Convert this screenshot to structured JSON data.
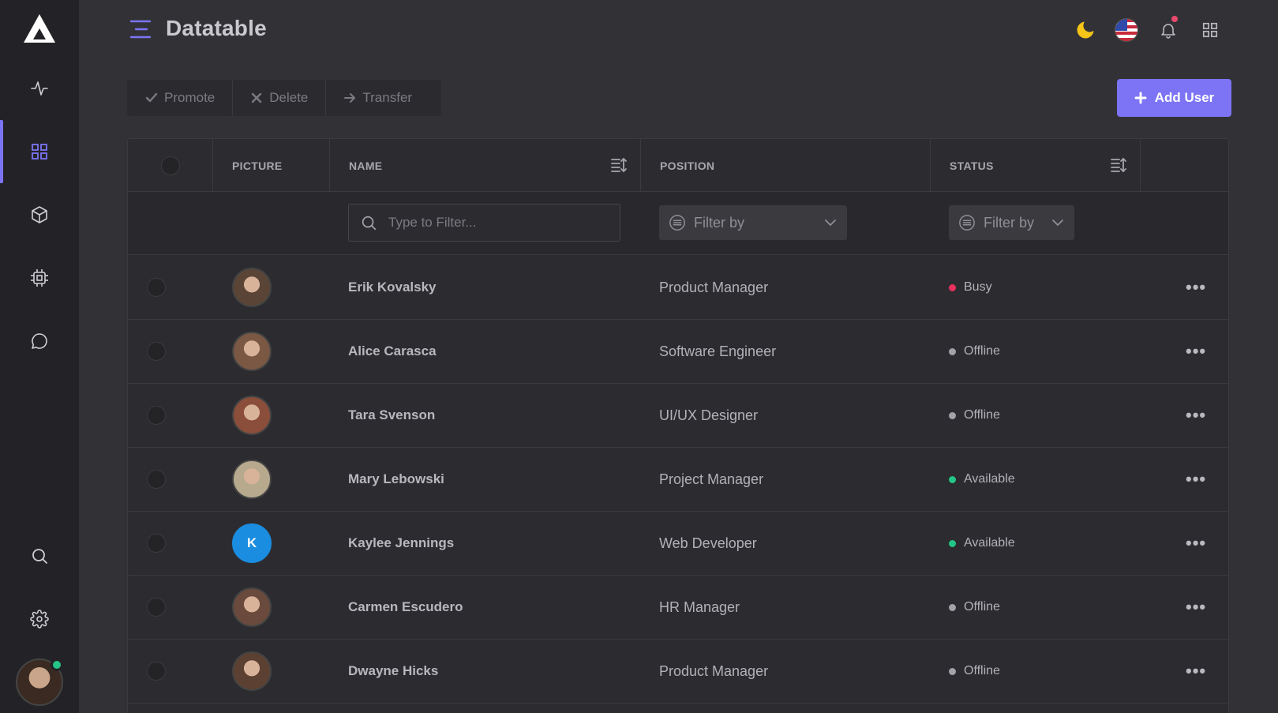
{
  "header": {
    "title": "Datatable",
    "icons": [
      "menu-icon",
      "moon-icon",
      "us-flag-icon",
      "bell-icon",
      "apps-grid-icon"
    ]
  },
  "sidebar": {
    "items": [
      {
        "icon": "activity-icon"
      },
      {
        "icon": "dashboard-grid-icon",
        "active": true
      },
      {
        "icon": "box-icon"
      },
      {
        "icon": "cpu-icon"
      },
      {
        "icon": "chat-icon"
      },
      {
        "icon": "search-icon"
      },
      {
        "icon": "gear-icon"
      }
    ],
    "user_status_color": "#25c487"
  },
  "toolbar": {
    "promote_label": "Promote",
    "delete_label": "Delete",
    "transfer_label": "Transfer",
    "add_user_label": "Add User"
  },
  "table": {
    "columns": {
      "picture": "PICTURE",
      "name": "NAME",
      "position": "POSITION",
      "status": "STATUS"
    },
    "filters": {
      "name_placeholder": "Type to Filter...",
      "position_select": "Filter by",
      "status_select": "Filter by"
    },
    "rows": [
      {
        "name": "Erik Kovalsky",
        "position": "Product Manager",
        "status": "Busy",
        "status_color": "#e8305f",
        "avatar_initial": "",
        "avatar_color": "#5a4436"
      },
      {
        "name": "Alice Carasca",
        "position": "Software Engineer",
        "status": "Offline",
        "status_color": "#a2a2aa",
        "avatar_initial": "",
        "avatar_color": "#7a5844"
      },
      {
        "name": "Tara Svenson",
        "position": "UI/UX Designer",
        "status": "Offline",
        "status_color": "#a2a2aa",
        "avatar_initial": "",
        "avatar_color": "#8a4e3a"
      },
      {
        "name": "Mary Lebowski",
        "position": "Project Manager",
        "status": "Available",
        "status_color": "#25c487",
        "avatar_initial": "",
        "avatar_color": "#b7a98e"
      },
      {
        "name": "Kaylee Jennings",
        "position": "Web Developer",
        "status": "Available",
        "status_color": "#25c487",
        "avatar_initial": "K",
        "avatar_color": "#1a8de0"
      },
      {
        "name": "Carmen Escudero",
        "position": "HR Manager",
        "status": "Offline",
        "status_color": "#a2a2aa",
        "avatar_initial": "",
        "avatar_color": "#6a4a3c"
      },
      {
        "name": "Dwayne Hicks",
        "position": "Product Manager",
        "status": "Offline",
        "status_color": "#a2a2aa",
        "avatar_initial": "",
        "avatar_color": "#5c4032"
      }
    ]
  },
  "colors": {
    "accent": "#7c74f5",
    "background": "#323236",
    "sidebar": "#232327"
  }
}
